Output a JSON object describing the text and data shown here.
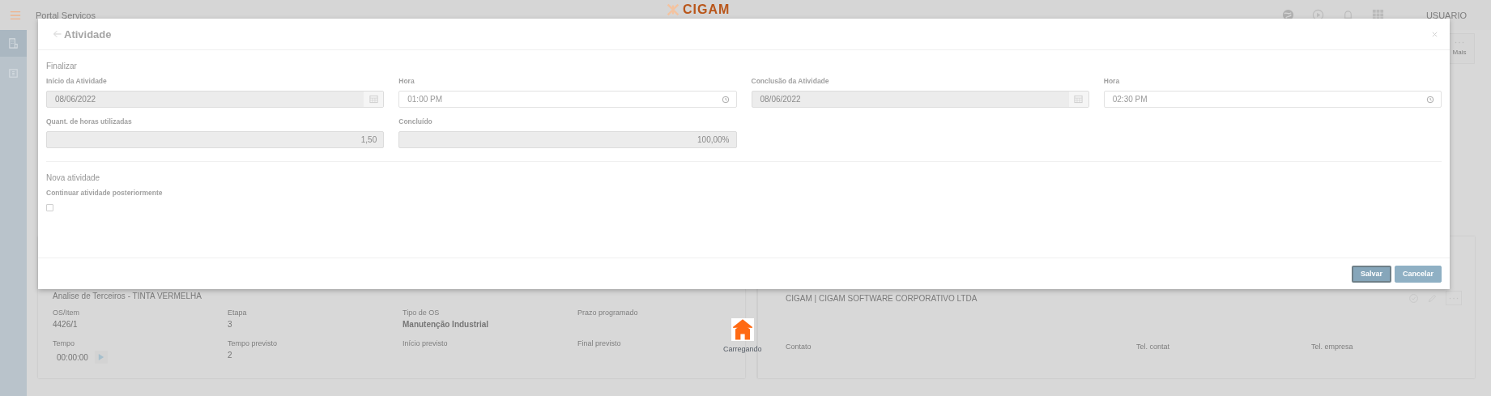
{
  "topbar": {
    "app_title": "Portal Serviços",
    "logo": "CIGAM",
    "user": "USUARIO"
  },
  "toolbar": {
    "more": "Mais"
  },
  "modal": {
    "title": "Atividade",
    "sections": [
      {
        "heading": "Finalizar",
        "fields": [
          {
            "label": "Início da Atividade",
            "value": "08/06/2022",
            "kind": "date",
            "disabled": true
          },
          {
            "label": "Hora",
            "value": "01:00 PM",
            "kind": "time",
            "disabled": false
          },
          {
            "label": "Conclusão da Atividade",
            "value": "08/06/2022",
            "kind": "date",
            "disabled": true
          },
          {
            "label": "Hora",
            "value": "02:30 PM",
            "kind": "time",
            "disabled": false
          },
          {
            "label": "Quant. de horas utilizadas",
            "value": "1,50",
            "kind": "number",
            "disabled": true
          },
          {
            "label": "Concluído",
            "value": "100,00%",
            "kind": "number",
            "disabled": true
          }
        ]
      },
      {
        "heading": "Nova atividade",
        "checkbox": {
          "label": "Continuar atividade posteriormente",
          "checked": false
        }
      }
    ],
    "buttons": [
      {
        "label": "Salvar",
        "focused": true
      },
      {
        "label": "Cancelar",
        "focused": false
      }
    ]
  },
  "cards": [
    {
      "title": "Analise de Terceiros - TINTA VERMELHA",
      "kind": "order",
      "fields": [
        {
          "label": "OS/Item",
          "value": "4426/1",
          "kind": "text"
        },
        {
          "label": "Etapa",
          "value": "3",
          "kind": "text"
        },
        {
          "label": "Tipo de OS",
          "value": "Manutenção Industrial",
          "kind": "strong"
        },
        {
          "label": "Prazo programado",
          "kind": "text"
        },
        {
          "label": "Tempo",
          "value": "00:00:00",
          "kind": "timer"
        },
        {
          "label": "Tempo previsto",
          "value": "2",
          "kind": "text"
        },
        {
          "label": "Início previsto",
          "kind": "text"
        },
        {
          "label": "Final previsto",
          "kind": "text"
        }
      ]
    },
    {
      "title": "CIGAM | CIGAM SOFTWARE CORPORATIVO LTDA",
      "kind": "client",
      "fields": [
        {
          "label": "Contato",
          "kind": "text"
        },
        {
          "label": "Tel. contat",
          "kind": "text"
        },
        {
          "label": "Tel. empresa",
          "kind": "text"
        }
      ]
    }
  ],
  "loading": {
    "label": "Carregando"
  }
}
